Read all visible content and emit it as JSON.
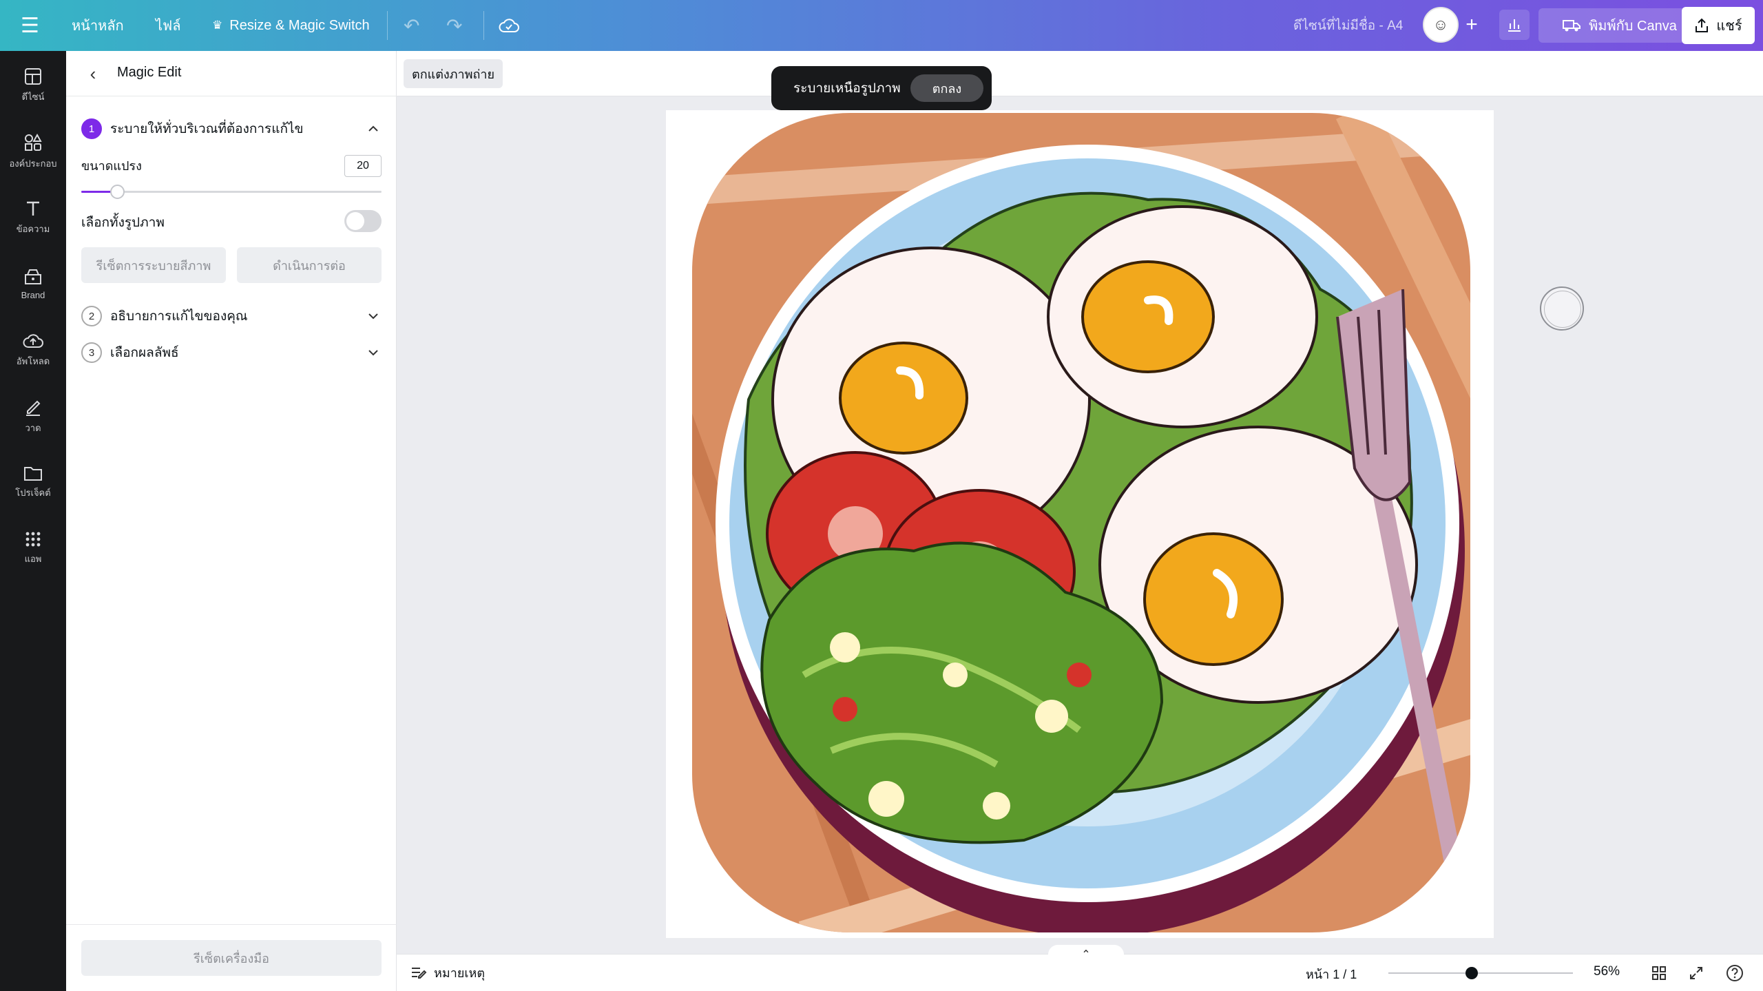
{
  "topbar": {
    "home": "หน้าหลัก",
    "file": "ไฟล์",
    "resize": "Resize & Magic Switch",
    "doc_title": "ดีไซน์ที่ไม่มีชื่อ - A4",
    "print": "พิมพ์กับ Canva",
    "share": "แชร์"
  },
  "rail": {
    "items": [
      {
        "label": "ดีไซน์",
        "icon": "layout-icon"
      },
      {
        "label": "องค์ประกอบ",
        "icon": "shapes-icon"
      },
      {
        "label": "ข้อความ",
        "icon": "text-icon"
      },
      {
        "label": "Brand",
        "icon": "brand-icon"
      },
      {
        "label": "อัพโหลด",
        "icon": "upload-icon"
      },
      {
        "label": "วาด",
        "icon": "draw-icon"
      },
      {
        "label": "โปรเจ็คต์",
        "icon": "folder-icon"
      },
      {
        "label": "แอพ",
        "icon": "apps-icon"
      }
    ]
  },
  "panel": {
    "title": "Magic Edit",
    "steps": [
      {
        "num": "1",
        "label": "ระบายให้ทั่วบริเวณที่ต้องการแก้ไข",
        "expanded": true
      },
      {
        "num": "2",
        "label": "อธิบายการแก้ไขของคุณ",
        "expanded": false
      },
      {
        "num": "3",
        "label": "เลือกผลลัพธ์",
        "expanded": false
      }
    ],
    "brush_size_label": "ขนาดแปรง",
    "brush_size_value": "20",
    "brush_size_fraction": 0.12,
    "select_all_label": "เลือกทั้งรูปภาพ",
    "select_all_on": false,
    "reset_brush": "รีเซ็ตการระบายสีภาพ",
    "continue": "ดำเนินการต่อ",
    "reset_tool": "รีเซ็ตเครื่องมือ"
  },
  "canvas": {
    "photo_edit": "ตกแต่งภาพถ่าย",
    "hint": "ระบายเหนือรูปภาพ",
    "ok": "ตกลง"
  },
  "bottombar": {
    "notes": "หมายเหตุ",
    "page": "หน้า 1 / 1",
    "zoom": "56%",
    "zoom_fraction": 0.45
  },
  "colors": {
    "accent": "#7d2ae8",
    "rail_bg": "#18191b"
  }
}
